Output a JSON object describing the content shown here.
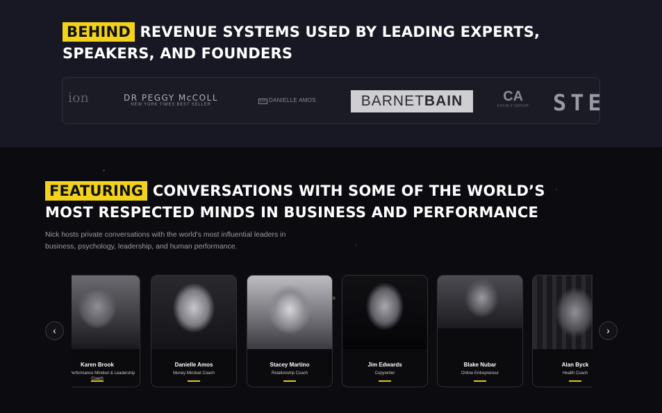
{
  "partners": {
    "highlight": "BEHIND",
    "headline": "REVENUE SYSTEMS USED BY LEADING EXPERTS, SPEAKERS, AND FOUNDERS",
    "logos": {
      "ion": "ion",
      "peggy_name": "DR PEGGY McCOLL",
      "peggy_sub": "NEW YORK TIMES BEST SELLER",
      "danielle": "DANIELLE AMOS",
      "barnet_light": "BARNET",
      "barnet_bold": "BAIN",
      "focaly_mark": "CA",
      "focaly_text": "FOCALY GROUP",
      "ste": "STE"
    }
  },
  "featuring": {
    "highlight": "FEATURING",
    "headline": "CONVERSATIONS WITH SOME OF THE WORLD’S MOST RESPECTED MINDS IN BUSINESS AND PERFORMANCE",
    "description": "Nick hosts private conversations with the world's most influential leaders in business, psychology, leadership, and human performance."
  },
  "guests": [
    {
      "name": "Karen Brook",
      "role": "High-Performance Mindset & Leadership Coach"
    },
    {
      "name": "Danielle Amos",
      "role": "Money Mindset Coach"
    },
    {
      "name": "Stacey Martino",
      "role": "Relationship Coach"
    },
    {
      "name": "Jim Edwards",
      "role": "Copywriter"
    },
    {
      "name": "Blake Nubar",
      "role": "Online Entrepreneur"
    },
    {
      "name": "Alan Byck",
      "role": "Health Coach"
    }
  ],
  "controls": {
    "prev_icon": "‹",
    "next_icon": "›"
  },
  "colors": {
    "accent": "#f2d21b",
    "background_top": "#181824",
    "background_bottom": "#0c0c10"
  }
}
